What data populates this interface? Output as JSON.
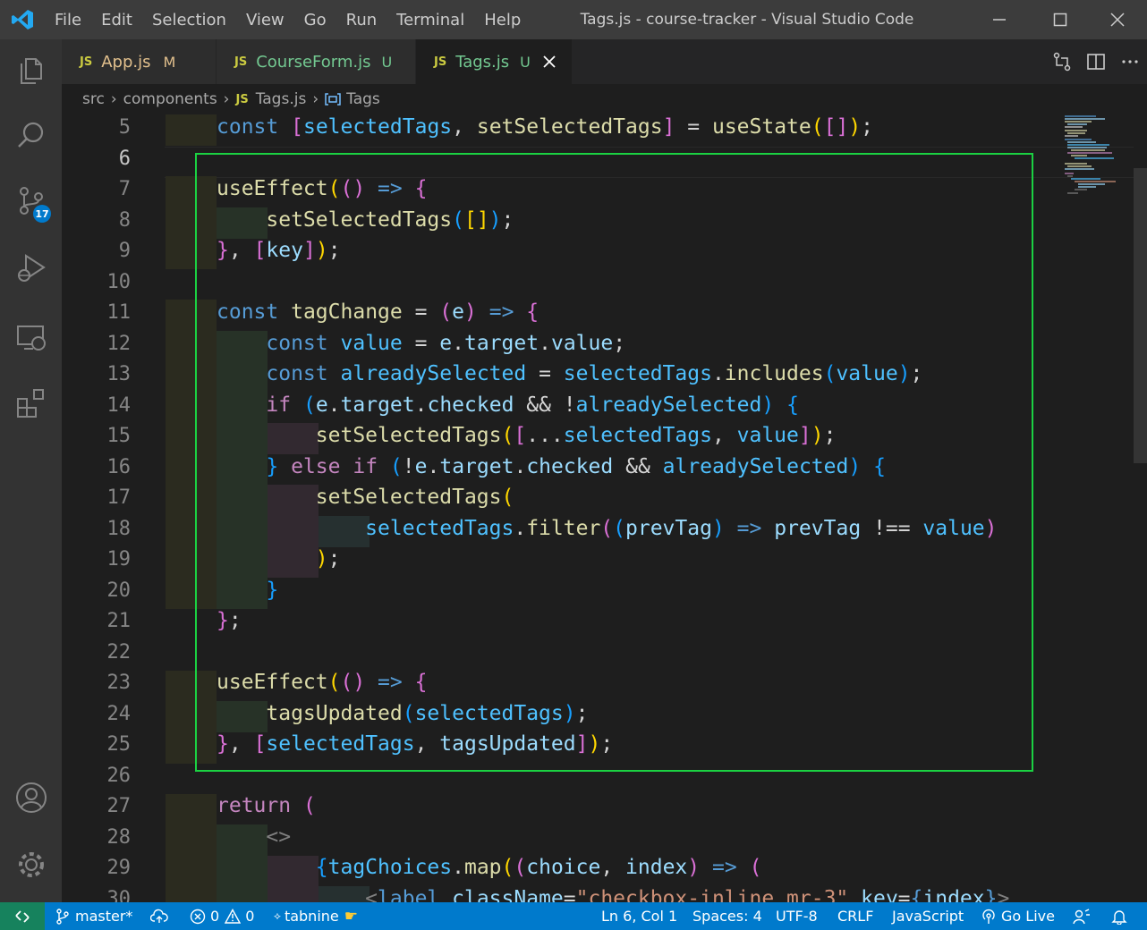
{
  "window": {
    "title": "Tags.js - course-tracker - Visual Studio Code",
    "menu": [
      "File",
      "Edit",
      "Selection",
      "View",
      "Go",
      "Run",
      "Terminal",
      "Help"
    ]
  },
  "activity_bar": {
    "items": [
      "explorer-icon",
      "search-icon",
      "source-control-icon",
      "run-debug-icon",
      "remote-explorer-icon",
      "extensions-icon"
    ],
    "scm_badge": "17",
    "bottom": [
      "accounts-icon",
      "manage-gear-icon"
    ]
  },
  "tabs": [
    {
      "icon": "JS",
      "label": "App.js",
      "status": "M",
      "active": false
    },
    {
      "icon": "JS",
      "label": "CourseForm.js",
      "status": "U",
      "active": false
    },
    {
      "icon": "JS",
      "label": "Tags.js",
      "status": "U",
      "active": true
    }
  ],
  "breadcrumb": {
    "parts": [
      "src",
      "components",
      "Tags.js",
      "Tags"
    ],
    "js_icon": "JS"
  },
  "editor": {
    "line_numbers": [
      "5",
      "6",
      "7",
      "8",
      "9",
      "10",
      "11",
      "12",
      "13",
      "14",
      "15",
      "16",
      "17",
      "18",
      "19",
      "20",
      "21",
      "22",
      "23",
      "24",
      "25",
      "26",
      "27",
      "28",
      "29",
      "30"
    ],
    "current_line": "6"
  },
  "status_bar": {
    "branch": "master*",
    "errors": "0",
    "warnings": "0",
    "tabnine": "tabnine",
    "position": "Ln 6, Col 1",
    "spaces": "Spaces: 4",
    "encoding": "UTF-8",
    "eol": "CRLF",
    "language": "JavaScript",
    "go_live": "Go Live"
  },
  "colors": {
    "accent": "#007acc",
    "highlight_box": "#1bd142",
    "remote": "#16825d"
  }
}
